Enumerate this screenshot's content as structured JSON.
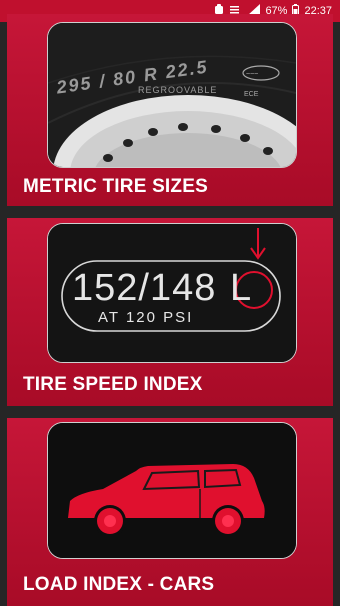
{
  "status_bar": {
    "battery": "67%",
    "time": "22:37"
  },
  "cards": [
    {
      "label": "METRIC TIRE SIZES",
      "tire_text": "295 / 80 R 22.5",
      "tire_sub": "REGROOVABLE"
    },
    {
      "label": "TIRE SPEED INDEX",
      "code": "152/148",
      "speed_letter": "L",
      "sub": "AT 120 PSI"
    },
    {
      "label": "LOAD INDEX - CARS"
    }
  ]
}
